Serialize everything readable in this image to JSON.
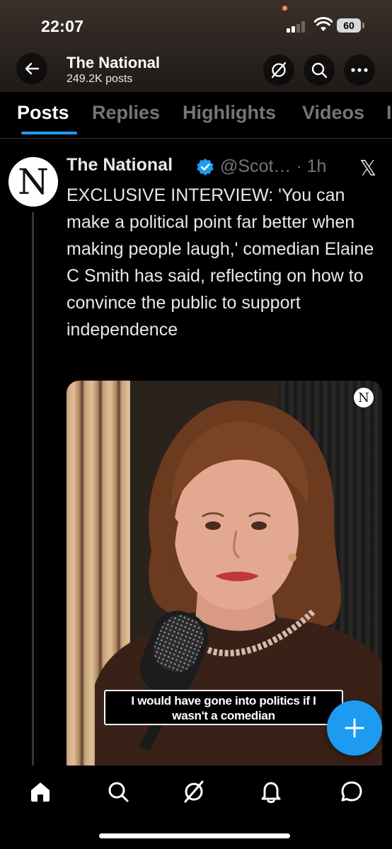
{
  "status_bar": {
    "time": "22:07",
    "battery": "60"
  },
  "header": {
    "title": "The National",
    "subtitle": "249.2K posts",
    "icons": [
      "back-arrow-icon",
      "grok-icon",
      "search-icon",
      "more-icon"
    ]
  },
  "tabs": [
    {
      "label": "Posts",
      "active": true
    },
    {
      "label": "Replies",
      "active": false
    },
    {
      "label": "Highlights",
      "active": false
    },
    {
      "label": "Videos",
      "active": false
    },
    {
      "label": "I",
      "active": false
    }
  ],
  "post": {
    "avatar_letter": "N",
    "author": "The National",
    "handle_time": "@Scot… · 1h",
    "text": "EXCLUSIVE INTERVIEW: 'You can make a political point far better when making people laugh,' comedian Elaine C Smith has said, reflecting on how to convince the public to support independence",
    "media": {
      "badge_letter": "N",
      "caption_line1": "I would have gone into politics if I",
      "caption_line2": "wasn't a comedian"
    }
  },
  "fab": {
    "icon": "plus-icon"
  },
  "bottom_nav": [
    "home-icon",
    "search-icon",
    "grok-icon",
    "notifications-icon",
    "messages-icon"
  ],
  "colors": {
    "accent": "#1d9bf0",
    "background": "#000000",
    "muted_text": "#71767b",
    "text": "#e7e9ea"
  }
}
